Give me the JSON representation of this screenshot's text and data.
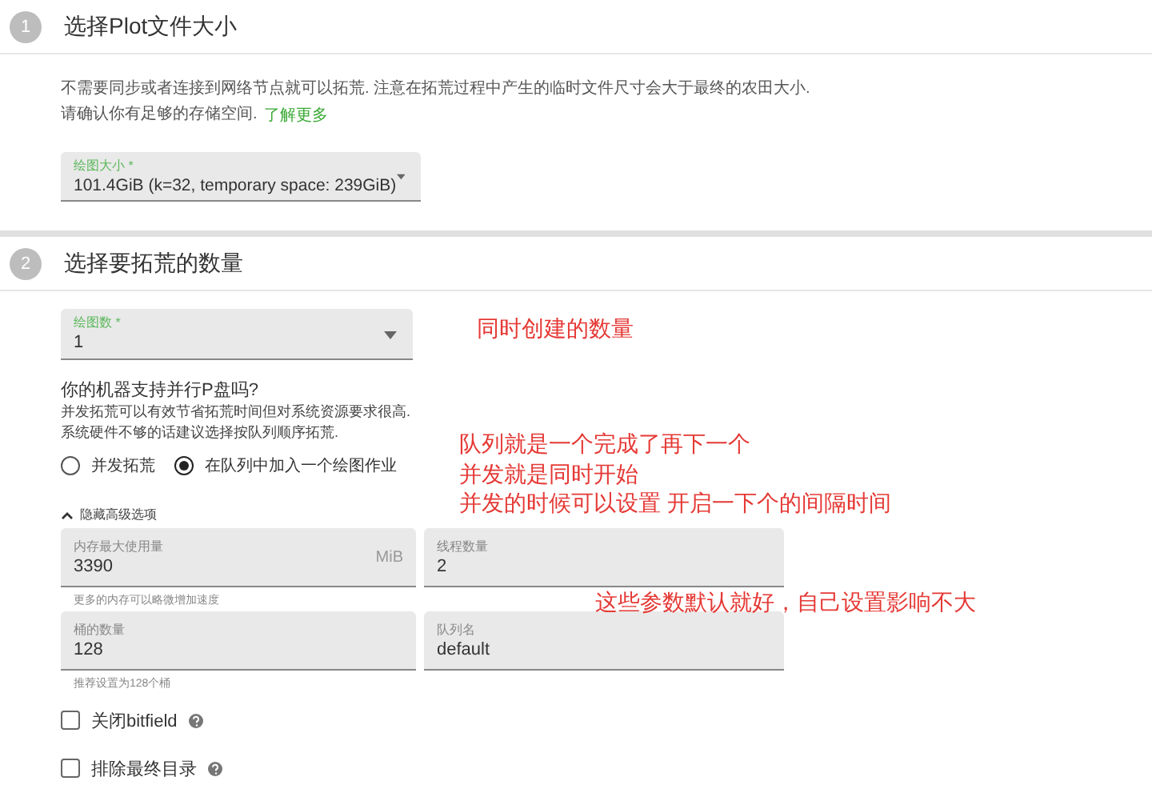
{
  "steps": [
    {
      "number": "1",
      "title": "选择Plot文件大小"
    },
    {
      "number": "2",
      "title": "选择要拓荒的数量"
    }
  ],
  "plot_size": {
    "description": "不需要同步或者连接到网络节点就可以拓荒. 注意在拓荒过程中产生的临时文件尺寸会大于最终的农田大小.",
    "description_2": "请确认你有足够的存储空间.",
    "learn_more": "了解更多",
    "label": "绘图大小 *",
    "value": "101.4GiB (k=32, temporary space: 239GiB)"
  },
  "plot_count": {
    "label": "绘图数 *",
    "value": "1"
  },
  "parallel": {
    "question": "你的机器支持并行P盘吗?",
    "hint": "并发拓荒可以有效节省拓荒时间但对系统资源要求很高. 系统硬件不够的话建议选择按队列顺序拓荒.",
    "options": [
      {
        "label": "并发拓荒",
        "selected": false
      },
      {
        "label": "在队列中加入一个绘图作业",
        "selected": true
      }
    ]
  },
  "advanced": {
    "toggle": "隐藏高级选项",
    "expanded": true,
    "fields": [
      {
        "label": "内存最大使用量",
        "value": "3390",
        "unit": "MiB",
        "helper": "更多的内存可以略微增加速度"
      },
      {
        "label": "线程数量",
        "value": "2"
      },
      {
        "label": "桶的数量",
        "value": "128",
        "helper": "推荐设置为128个桶"
      },
      {
        "label": "队列名",
        "value": "default"
      }
    ],
    "checkboxes": [
      {
        "label": "关闭bitfield",
        "checked": false
      },
      {
        "label": "排除最终目录",
        "checked": false
      }
    ]
  },
  "annotations": [
    {
      "lines": [
        "同时创建的数量"
      ]
    },
    {
      "lines": [
        "队列就是一个完成了再下一个",
        "并发就是同时开始",
        "并发的时候可以设置 开启一下个的间隔时间"
      ]
    },
    {
      "lines": [
        "这些参数默认就好，自己设置影响不大"
      ]
    }
  ]
}
